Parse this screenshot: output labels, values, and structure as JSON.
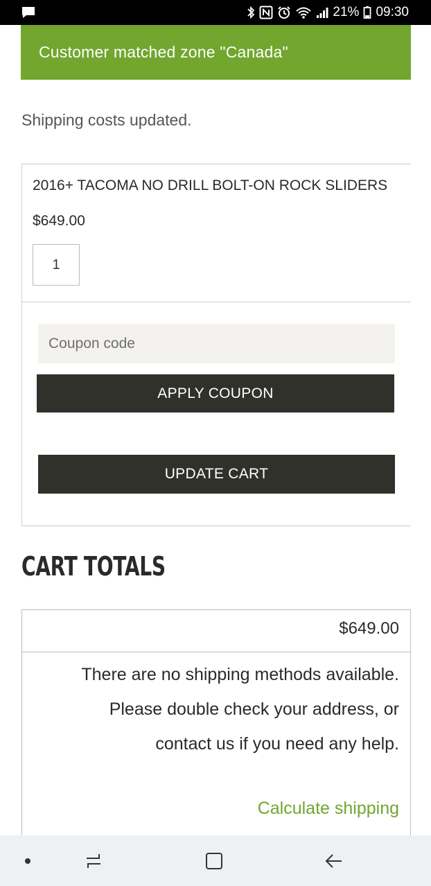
{
  "status_bar": {
    "battery_percent": "21%",
    "time": "09:30",
    "icons": [
      "message-icon",
      "bluetooth-icon",
      "nfc-icon",
      "alarm-icon",
      "wifi-icon",
      "signal-icon",
      "battery-icon"
    ]
  },
  "notice": {
    "text": "Customer matched zone \"Canada\"",
    "color": "#72a62f"
  },
  "shipping_message": "Shipping costs updated.",
  "cart_item": {
    "name": "2016+ TACOMA NO DRILL BOLT-ON ROCK SLIDERS",
    "price": "$649.00",
    "quantity": "1"
  },
  "coupon": {
    "placeholder": "Coupon code",
    "apply_label": "APPLY COUPON"
  },
  "update_cart_label": "UPDATE CART",
  "cart_totals": {
    "title": "CART TOTALS",
    "subtotal": "$649.00",
    "shipping_lines": [
      "There are no shipping methods available.",
      "Please double check your address, or",
      "contact us if you need any help."
    ],
    "calculate_shipping_label": "Calculate shipping"
  },
  "nav_bar": {
    "icons": [
      "dot-icon",
      "recent-apps-icon",
      "home-icon",
      "back-icon"
    ]
  },
  "colors": {
    "accent_green": "#72a62f",
    "button_dark": "#30312b",
    "coupon_bg": "#f4f2ee"
  }
}
